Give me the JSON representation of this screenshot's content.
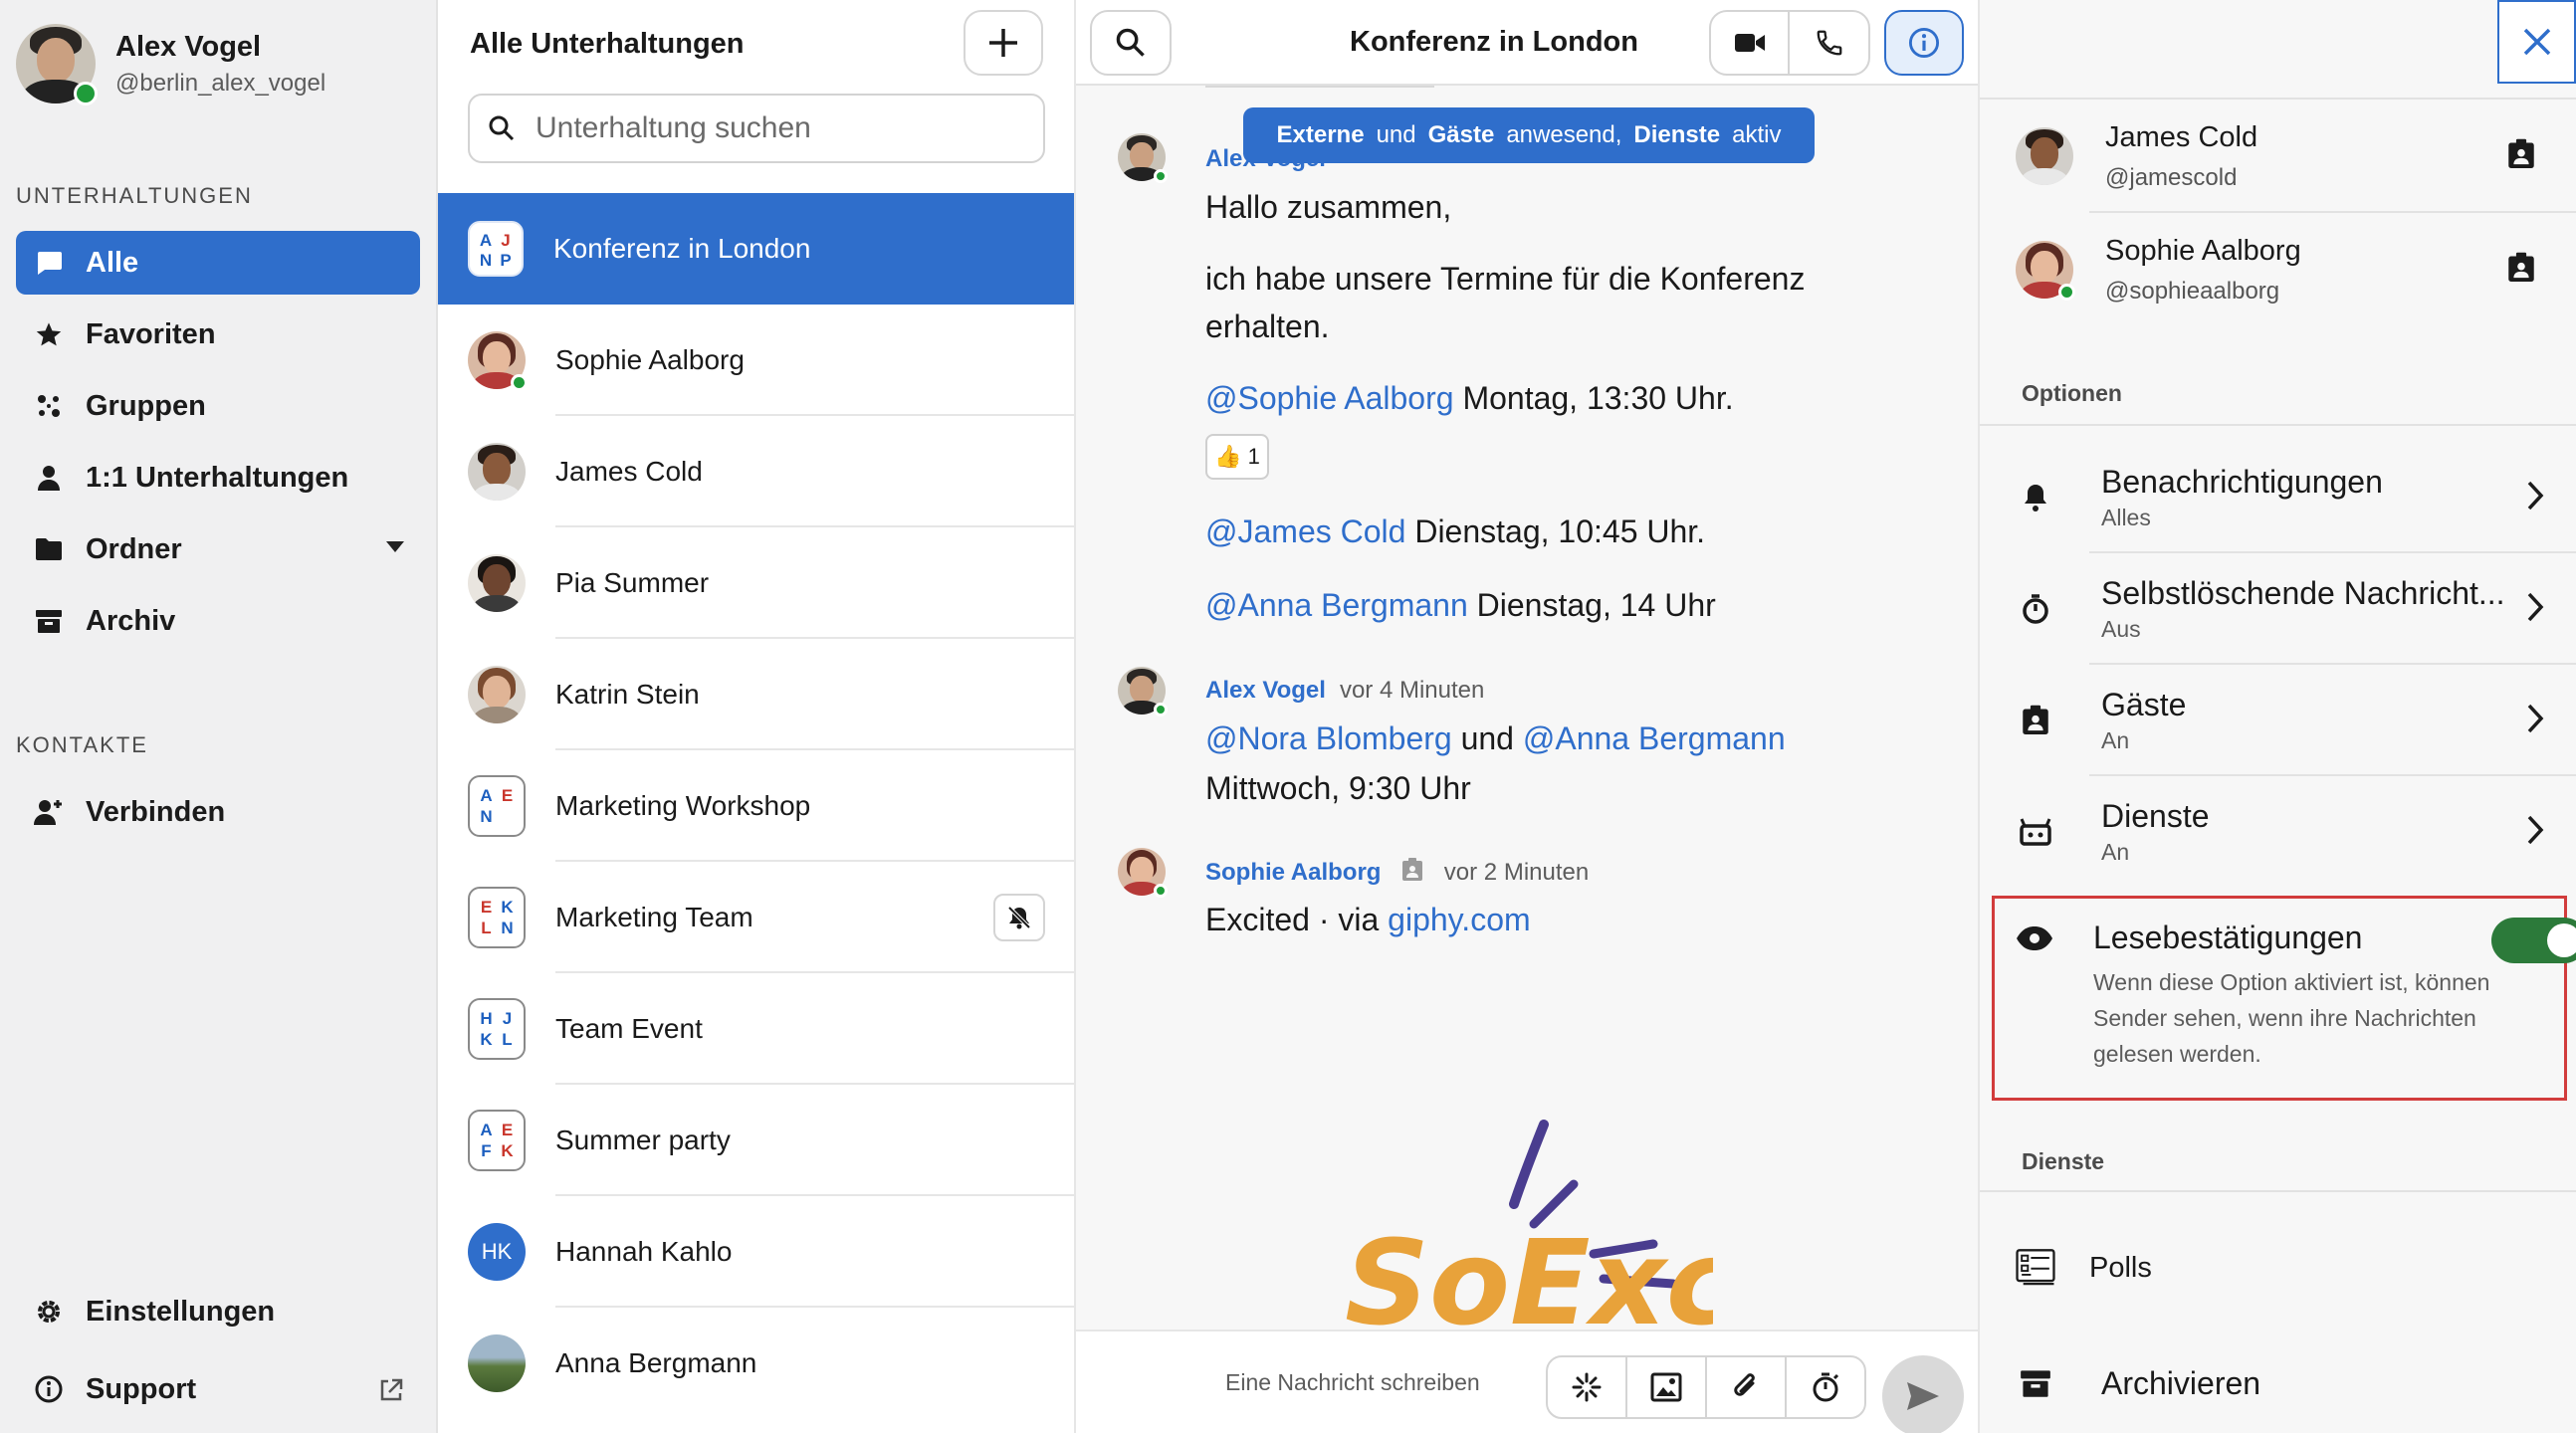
{
  "user": {
    "name": "Alex Vogel",
    "handle": "@berlin_alex_vogel"
  },
  "nav": {
    "section_conversations": "UNTERHALTUNGEN",
    "items": [
      {
        "label": "Alle"
      },
      {
        "label": "Favoriten"
      },
      {
        "label": "Gruppen"
      },
      {
        "label": "1:1 Unterhaltungen"
      },
      {
        "label": "Ordner"
      },
      {
        "label": "Archiv"
      }
    ],
    "section_contacts": "KONTAKTE",
    "connect_label": "Verbinden",
    "settings_label": "Einstellungen",
    "support_label": "Support"
  },
  "conversations": {
    "title": "Alle Unterhaltungen",
    "search_placeholder": "Unterhaltung suchen",
    "items": [
      {
        "name": "Konferenz in London",
        "initials": [
          "A",
          "J",
          "N",
          "P"
        ]
      },
      {
        "name": "Sophie Aalborg"
      },
      {
        "name": "James Cold"
      },
      {
        "name": "Pia Summer"
      },
      {
        "name": "Katrin Stein"
      },
      {
        "name": "Marketing Workshop",
        "initials": [
          "A",
          "E",
          "N",
          ""
        ]
      },
      {
        "name": "Marketing Team",
        "initials": [
          "E",
          "K",
          "L",
          "N"
        ]
      },
      {
        "name": "Team Event",
        "initials": [
          "H",
          "J",
          "K",
          "L"
        ]
      },
      {
        "name": "Summer party",
        "initials": [
          "A",
          "E",
          "F",
          "K"
        ]
      },
      {
        "name": "Hannah Kahlo",
        "initials": [
          "HK"
        ]
      },
      {
        "name": "Anna Bergmann"
      }
    ]
  },
  "chat": {
    "title": "Konferenz in London",
    "banner": {
      "part1": "Externe",
      "part2": "und",
      "part3": "Gäste",
      "part4": "anwesend,",
      "part5": "Dienste",
      "part6": "aktiv"
    },
    "msg1": {
      "author": "Alex Vogel",
      "line1": "Hallo zusammen,",
      "line2a": "ich habe unsere Termine für die Konferenz",
      "line2b": "erhalten.",
      "m1_mention": "@Sophie Aalborg",
      "m1_text": " Montag, 13:30 Uhr.",
      "reaction_emoji": "👍",
      "reaction_count": "1",
      "m2_mention": "@James Cold",
      "m2_text": " Dienstag, 10:45 Uhr.",
      "m3_mention": "@Anna Bergmann",
      "m3_text": " Dienstag, 14 Uhr"
    },
    "msg2": {
      "author": "Alex Vogel",
      "time": "vor 4 Minuten",
      "mention1": "@Nora Blomberg",
      "and": " und ",
      "mention2": "@Anna Bergmann",
      "line2": "Mittwoch, 9:30 Uhr"
    },
    "msg3": {
      "author": "Sophie Aalborg",
      "time": "vor 2 Minuten",
      "text": "Excited  · via ",
      "link": "giphy.com"
    },
    "gif_text": "SoExcited",
    "composer_placeholder": "Eine Nachricht schreiben"
  },
  "details": {
    "members": [
      {
        "name": "James Cold",
        "handle": "@jamescold"
      },
      {
        "name": "Sophie Aalborg",
        "handle": "@sophieaalborg"
      }
    ],
    "options_title": "Optionen",
    "options": [
      {
        "title": "Benachrichtigungen",
        "value": "Alles"
      },
      {
        "title": "Selbstlöschende Nachricht...",
        "value": "Aus"
      },
      {
        "title": "Gäste",
        "value": "An"
      },
      {
        "title": "Dienste",
        "value": "An"
      }
    ],
    "read_receipts": {
      "title": "Lesebestätigungen",
      "desc": "Wenn diese Option aktiviert ist, können Sender sehen, wenn ihre Nachrichten gelesen werden.",
      "enabled": true
    },
    "services_title": "Dienste",
    "polls_label": "Polls",
    "archive_label": "Archivieren"
  },
  "colors": {
    "accent": "#2f6ecb",
    "online": "#1f9c3a",
    "toggle_on": "#2c7a3a",
    "highlight": "#d23c3c"
  }
}
